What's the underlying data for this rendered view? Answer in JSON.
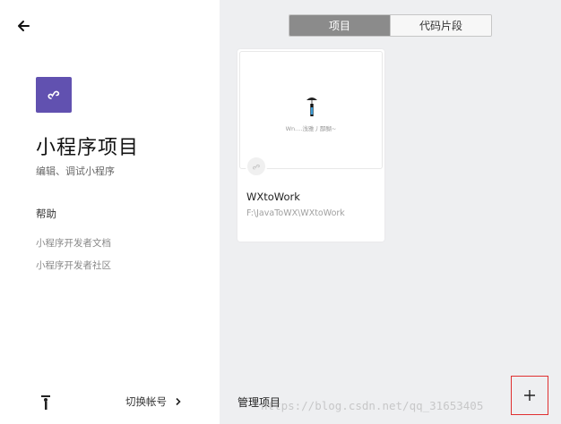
{
  "sidebar": {
    "back_icon": "arrow-left-icon",
    "logo_icon": "mini-program-logo-icon",
    "logo_color": "#6151b0",
    "title": "小程序项目",
    "subtitle": "编辑、调试小程序",
    "help_heading": "帮助",
    "help_links": [
      {
        "label": "小程序开发者文档"
      },
      {
        "label": "小程序开发者社区"
      }
    ],
    "switch_account_label": "切换帐号",
    "switch_account_icon": "chevron-right-icon"
  },
  "main": {
    "tabs": [
      {
        "label": "项目",
        "active": true
      },
      {
        "label": "代码片段",
        "active": false
      }
    ],
    "projects": [
      {
        "thumbnail_text": "Wn....浅雅丿鄙醐~",
        "name": "WXtoWork",
        "path": "F:\\JavaToWX\\WXtoWork"
      }
    ],
    "manage_label": "管理项目",
    "add_icon": "plus-icon",
    "highlight_color": "#e03030",
    "watermark": "https://blog.csdn.net/qq_31653405"
  }
}
